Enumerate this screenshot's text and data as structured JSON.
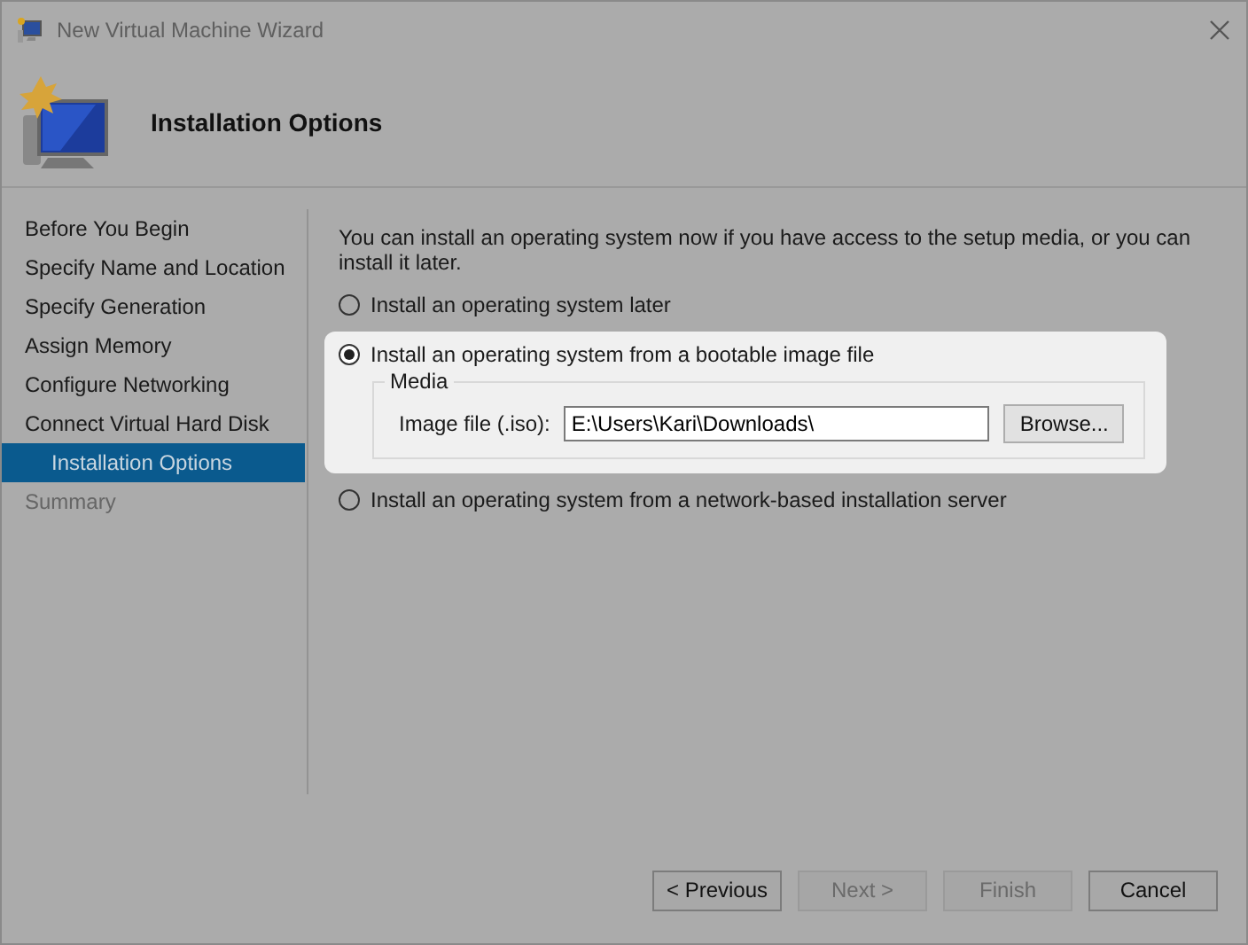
{
  "window": {
    "title": "New Virtual Machine Wizard"
  },
  "header": {
    "title": "Installation Options"
  },
  "steps": [
    {
      "label": "Before You Begin",
      "selected": false,
      "disabled": false
    },
    {
      "label": "Specify Name and Location",
      "selected": false,
      "disabled": false
    },
    {
      "label": "Specify Generation",
      "selected": false,
      "disabled": false
    },
    {
      "label": "Assign Memory",
      "selected": false,
      "disabled": false
    },
    {
      "label": "Configure Networking",
      "selected": false,
      "disabled": false
    },
    {
      "label": "Connect Virtual Hard Disk",
      "selected": false,
      "disabled": false
    },
    {
      "label": "Installation Options",
      "selected": true,
      "disabled": false
    },
    {
      "label": "Summary",
      "selected": false,
      "disabled": true
    }
  ],
  "intro": "You can install an operating system now if you have access to the setup media, or you can install it later.",
  "options": [
    {
      "label": "Install an operating system later",
      "selected": false
    },
    {
      "label": "Install an operating system from a bootable image file",
      "selected": true,
      "media": {
        "group_label": "Media",
        "field_label": "Image file (.iso):",
        "value": "E:\\Users\\Kari\\Downloads\\",
        "button": "Browse..."
      }
    },
    {
      "label": "Install an operating system from a network-based installation server",
      "selected": false
    }
  ],
  "buttons": [
    {
      "label": "< Previous",
      "disabled": false
    },
    {
      "label": "Next >",
      "disabled": true
    },
    {
      "label": "Finish",
      "disabled": true
    },
    {
      "label": "Cancel",
      "disabled": false
    }
  ]
}
